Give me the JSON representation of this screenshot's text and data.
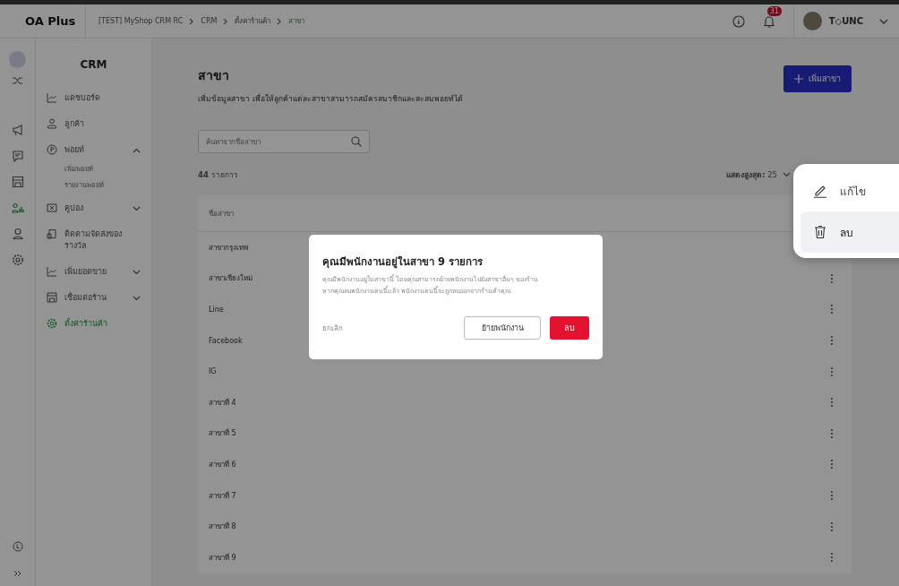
{
  "header": {
    "logo": "OA Plus",
    "breadcrumb": [
      {
        "label": "[TEST] MyShop CRM RC",
        "selected": false
      },
      {
        "label": "CRM",
        "selected": false
      },
      {
        "label": "ตั้งค่าร้านค้า",
        "selected": false
      },
      {
        "label": "สาขา",
        "selected": true
      }
    ],
    "notification_count": "31",
    "user_name": "T◇UNC"
  },
  "rail": [
    {
      "kind": "shuffle",
      "selected": false
    },
    {
      "kind": "megaphone",
      "selected": false
    },
    {
      "kind": "chat",
      "selected": false
    },
    {
      "kind": "store",
      "selected": false
    },
    {
      "kind": "crm",
      "selected": true
    },
    {
      "kind": "person",
      "selected": false
    },
    {
      "kind": "settings",
      "selected": false
    }
  ],
  "sidebar": {
    "title": "CRM",
    "items": [
      {
        "label": "แดชบอร์ด",
        "kind": "dashboard",
        "selected": false
      },
      {
        "label": "ลูกค้า",
        "kind": "customer",
        "selected": false
      },
      {
        "label": "พอยท์",
        "kind": "point",
        "selected": false,
        "expanded": true,
        "children": [
          {
            "label": "เพิ่มพอยท์"
          },
          {
            "label": "รายงานพอยท์"
          }
        ]
      },
      {
        "label": "คูปอง",
        "kind": "coupon",
        "selected": false,
        "expanded": false
      },
      {
        "label": "ติดตามจัดส่งของรางวัล",
        "kind": "delivery",
        "selected": false
      },
      {
        "label": "เพิ่มยอดขาย",
        "kind": "sales",
        "selected": false,
        "expanded": false
      },
      {
        "label": "เชื่อมต่อร้าน",
        "kind": "store",
        "selected": false,
        "expanded": false
      },
      {
        "label": "ตั้งค่าร้านค้า",
        "kind": "settings",
        "selected": true
      }
    ]
  },
  "page": {
    "title": "สาขา",
    "description": "เพิ่มข้อมูลสาขา เพื่อให้ลูกค้าแต่ละสาขาสามารถสมัครสมาชิกและสะสมพอยท์ได้",
    "add_button": "เพิ่มสาขา",
    "search": {
      "placeholder": "ค้นหาจากชื่อสาขา"
    },
    "count": "**44** รายการ",
    "page_size": "**แสดงสูงสุด:** 25"
  },
  "table": {
    "columns": [
      "ชื่อสาขา"
    ],
    "rows": [
      {
        "name": "สาขากรุงเทพ",
        "menu": [
          {
            "label": "แก้ไข",
            "kind": "edit",
            "selected": false
          },
          {
            "label": "ลบ",
            "kind": "delete",
            "selected": true
          }
        ]
      },
      {
        "name": "สาขาเชียงใหม่"
      },
      {
        "name": "Line"
      },
      {
        "name": "Facebook"
      },
      {
        "name": "IG"
      },
      {
        "name": "สาขาที่ 4"
      },
      {
        "name": "สาขาที่ 5"
      },
      {
        "name": "สาขาที่ 6"
      },
      {
        "name": "สาขาที่ 7"
      },
      {
        "name": "สาขาที่ 8"
      },
      {
        "name": "สาขาที่ 9"
      }
    ]
  },
  "dialog": {
    "title": "คุณมีพนักงานอยู่ในสาขา 9 รายการ",
    "lines": [
      "คุณมีพนักงานอยู่ในสาขานี้ โดยคุณสามารถย้ายพนักงานไปยังสาขาอื่นๆ ของร้าน",
      "หากคุณลบพนักงานคนนี้แล้ว พนักงานคนนี้จะถูกลบออกจากร้านค้าคุณ"
    ],
    "cancel": "ยกเลิก",
    "move_button": "ย้ายพนักงาน",
    "delete_button": "ลบ"
  }
}
